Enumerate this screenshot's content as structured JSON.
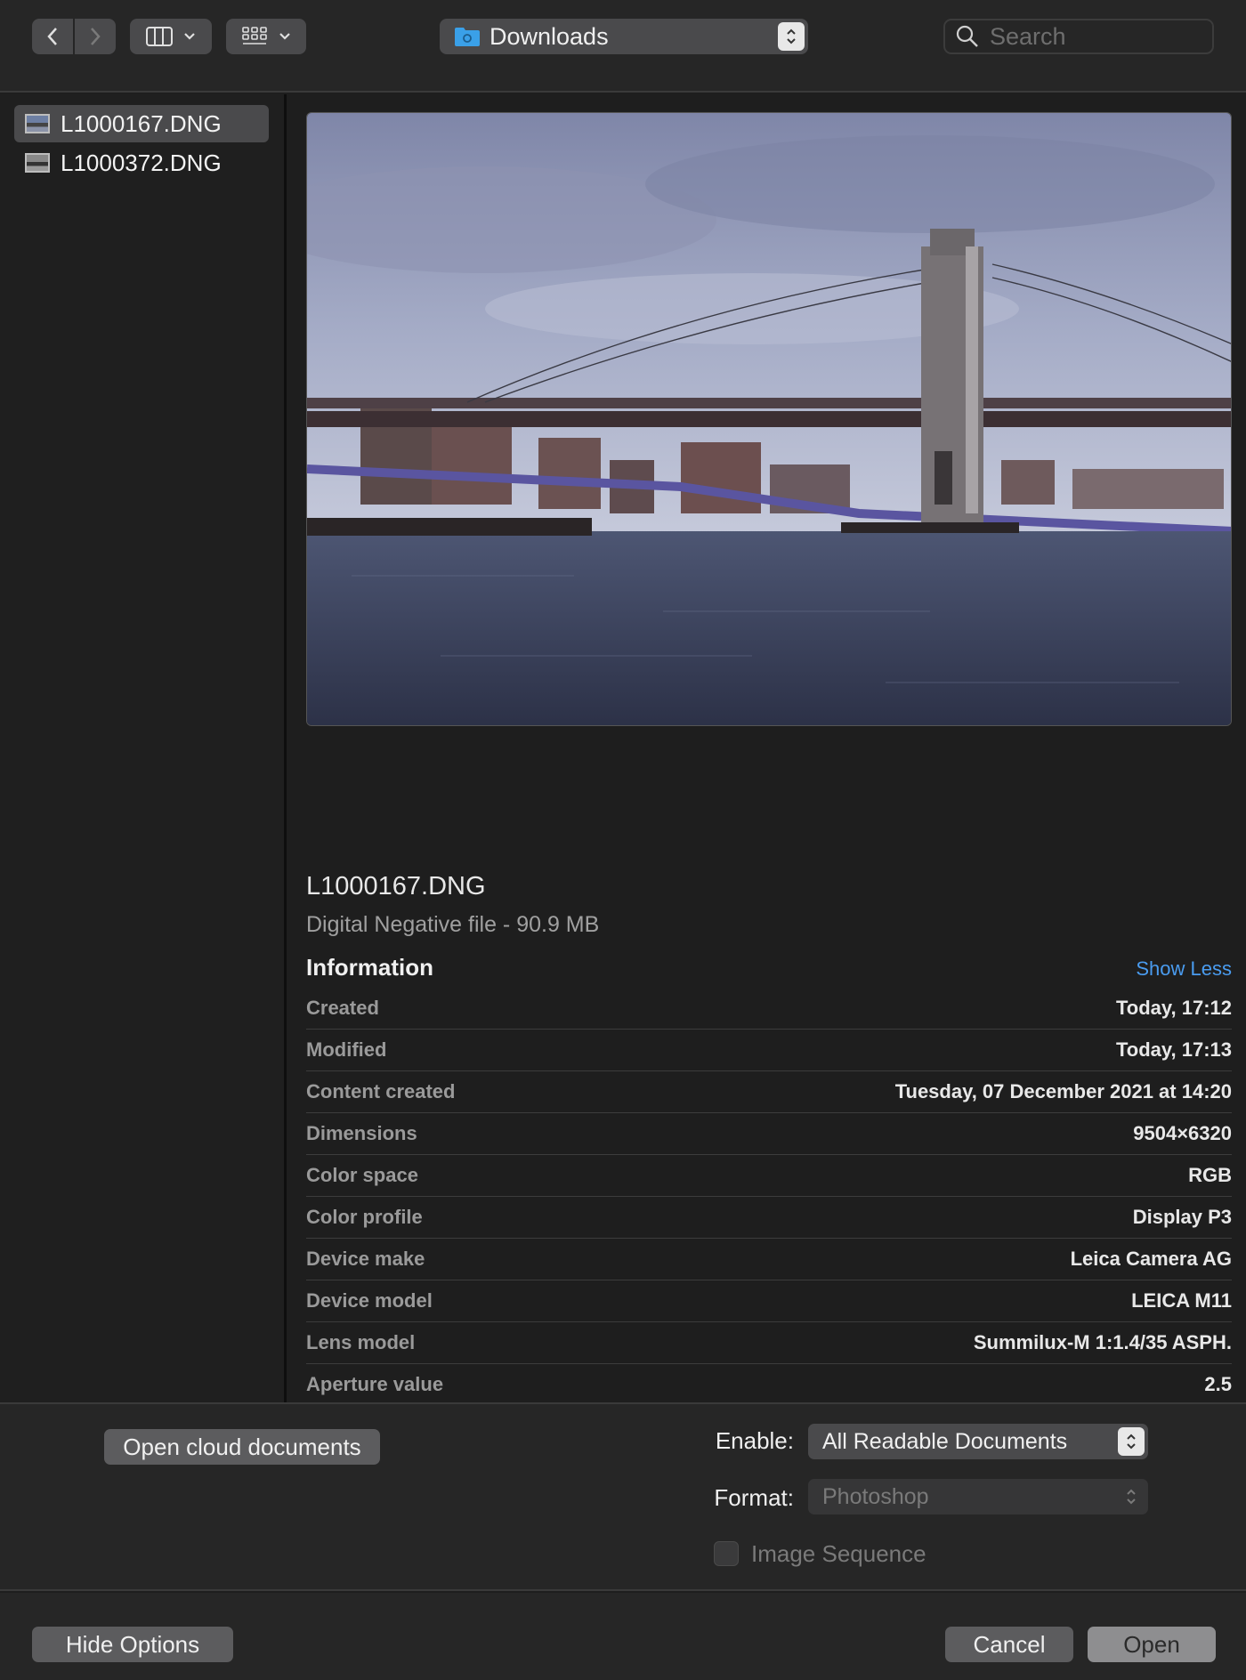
{
  "toolbar": {
    "back_icon": "chevron-left-icon",
    "forward_icon": "chevron-right-icon",
    "column_view_icon": "columns-icon",
    "group_icon": "grid-icon",
    "location": "Downloads",
    "search_placeholder": "Search"
  },
  "sidebar": {
    "files": [
      {
        "name": "L1000167.DNG",
        "selected": true
      },
      {
        "name": "L1000372.DNG",
        "selected": false
      }
    ]
  },
  "preview": {
    "file_name": "L1000167.DNG",
    "file_kind": "Digital Negative file - 90.9 MB",
    "info_heading": "Information",
    "show_less": "Show Less",
    "rows": [
      {
        "key": "Created",
        "value": "Today, 17:12"
      },
      {
        "key": "Modified",
        "value": "Today, 17:13"
      },
      {
        "key": "Content created",
        "value": "Tuesday, 07 December 2021 at 14:20"
      },
      {
        "key": "Dimensions",
        "value": "9504×6320"
      },
      {
        "key": "Color space",
        "value": "RGB"
      },
      {
        "key": "Color profile",
        "value": "Display P3"
      },
      {
        "key": "Device make",
        "value": "Leica Camera AG"
      },
      {
        "key": "Device model",
        "value": "LEICA M11"
      },
      {
        "key": "Lens model",
        "value": "Summilux-M 1:1.4/35 ASPH."
      },
      {
        "key": "Aperture value",
        "value": "2.5"
      }
    ]
  },
  "options": {
    "cloud_button": "Open cloud documents",
    "enable_label": "Enable:",
    "enable_value": "All Readable Documents",
    "format_label": "Format:",
    "format_value": "Photoshop",
    "image_sequence_label": "Image Sequence",
    "image_sequence_checked": false
  },
  "footer": {
    "hide_options": "Hide Options",
    "cancel": "Cancel",
    "open": "Open"
  },
  "colors": {
    "accent_link": "#4a9cf0",
    "background": "#1e1e1e",
    "folder_icon": "#3aa0e8"
  }
}
